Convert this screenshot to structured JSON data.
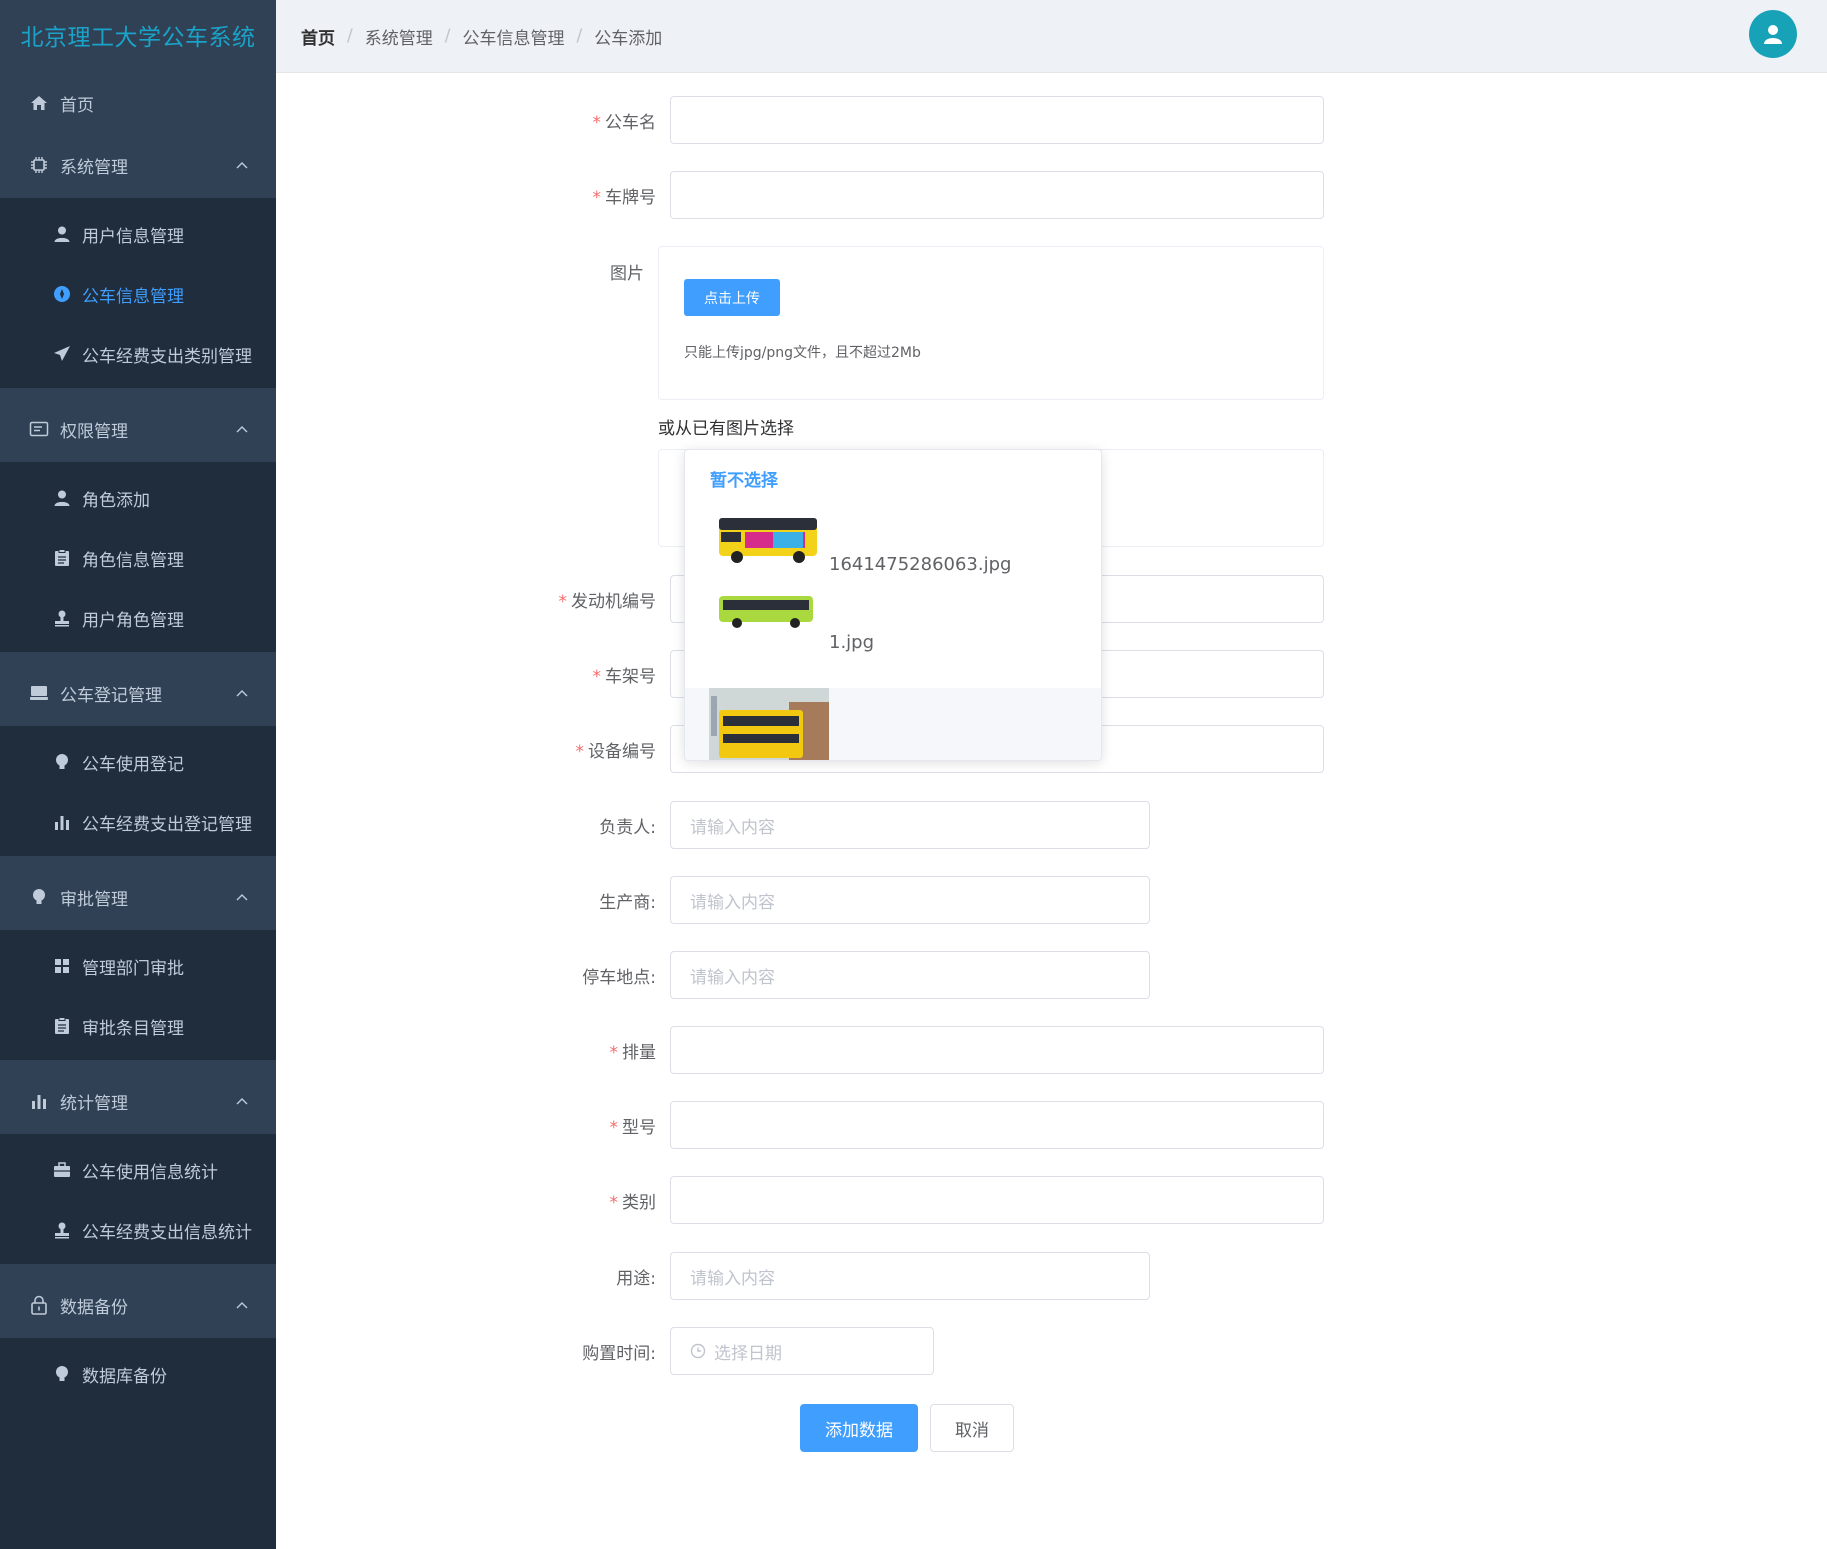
{
  "app": {
    "title": "北京理工大学公车系统"
  },
  "sidebar": {
    "home": "首页",
    "groups": [
      {
        "label": "系统管理",
        "icon": "cpu-icon",
        "items": [
          {
            "label": "用户信息管理",
            "icon": "user-icon"
          },
          {
            "label": "公车信息管理",
            "icon": "compass-icon",
            "active": true
          },
          {
            "label": "公车经费支出类别管理",
            "icon": "send-icon"
          }
        ]
      },
      {
        "label": "权限管理",
        "icon": "tickets-icon",
        "items": [
          {
            "label": "角色添加",
            "icon": "user-icon"
          },
          {
            "label": "角色信息管理",
            "icon": "clipboard-icon"
          },
          {
            "label": "用户角色管理",
            "icon": "stamp-icon"
          }
        ]
      },
      {
        "label": "公车登记管理",
        "icon": "monitor-icon",
        "items": [
          {
            "label": "公车使用登记",
            "icon": "bulb-icon"
          },
          {
            "label": "公车经费支出登记管理",
            "icon": "bar-chart-icon"
          }
        ]
      },
      {
        "label": "审批管理",
        "icon": "bulb-icon",
        "items": [
          {
            "label": "管理部门审批",
            "icon": "grid-icon"
          },
          {
            "label": "审批条目管理",
            "icon": "clipboard-icon"
          }
        ]
      },
      {
        "label": "统计管理",
        "icon": "bar-chart-icon",
        "items": [
          {
            "label": "公车使用信息统计",
            "icon": "briefcase-icon"
          },
          {
            "label": "公车经费支出信息统计",
            "icon": "stamp-icon"
          }
        ]
      },
      {
        "label": "数据备份",
        "icon": "lock-icon",
        "items": [
          {
            "label": "数据库备份",
            "icon": "bulb-icon"
          }
        ]
      }
    ]
  },
  "breadcrumb": [
    "首页",
    "系统管理",
    "公车信息管理",
    "公车添加"
  ],
  "form": {
    "name_label": "公车名",
    "plate_label": "车牌号",
    "image_label": "图片",
    "upload_button": "点击上传",
    "upload_tip": "只能上传jpg/png文件，且不超过2Mb",
    "pick_label": "或从已有图片选择",
    "dropdown": {
      "none_option": "暂不选择",
      "options": [
        "1641475286063.jpg",
        "1.jpg"
      ]
    },
    "engine_label": "发动机编号",
    "frame_label": "车架号",
    "device_label": "设备编号",
    "owner_label": "负责人:",
    "maker_label": "生产商:",
    "parking_label": "停车地点:",
    "displacement_label": "排量",
    "model_label": "型号",
    "category_label": "类别",
    "usage_label": "用途:",
    "purchase_label": "购置时间:",
    "placeholder": "请输入内容",
    "date_placeholder": "选择日期",
    "submit_button": "添加数据",
    "cancel_button": "取消"
  },
  "colors": {
    "sidebar_bg": "#304156",
    "submenu_bg": "#1f2d3d",
    "accent": "#409eff",
    "logo": "#1aa3c9",
    "required": "#f56c6c"
  }
}
